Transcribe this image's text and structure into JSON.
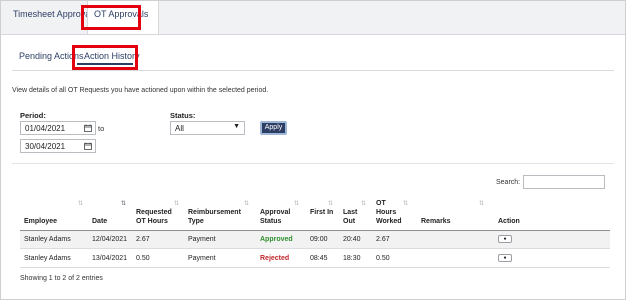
{
  "top_tabs": [
    "Timesheet Approvals",
    "OT Approvals"
  ],
  "sub_tabs": [
    "Pending Actions",
    "Action History"
  ],
  "description": "View details of all OT Requests you have actioned upon within the selected period.",
  "filters": {
    "period_label": "Period:",
    "from_date": "01/04/2021",
    "to_word": "to",
    "to_date": "30/04/2021",
    "status_label": "Status:",
    "status_value": "All",
    "apply_label": "Apply"
  },
  "search_label": "Search:",
  "table": {
    "headers": [
      "Employee",
      "Date",
      "Requested OT Hours",
      "Reimbursement Type",
      "Approval Status",
      "First In",
      "Last Out",
      "OT Hours Worked",
      "Remarks",
      "Action"
    ],
    "rows": [
      {
        "employee": "Stanley Adams",
        "date": "12/04/2021",
        "requested": "2.67",
        "type": "Payment",
        "status": "Approved",
        "first_in": "09:00",
        "last_out": "20:40",
        "worked": "2.67",
        "remarks": ""
      },
      {
        "employee": "Stanley Adams",
        "date": "13/04/2021",
        "requested": "0.50",
        "type": "Payment",
        "status": "Rejected",
        "first_in": "08:45",
        "last_out": "18:30",
        "worked": "0.50",
        "remarks": ""
      }
    ]
  },
  "footer_text": "Showing 1 to 2 of 2 entries",
  "colors": {
    "accent": "#2d3e64",
    "highlight": "#e3000f",
    "approved": "#2f8f2f",
    "rejected": "#c0282b"
  }
}
